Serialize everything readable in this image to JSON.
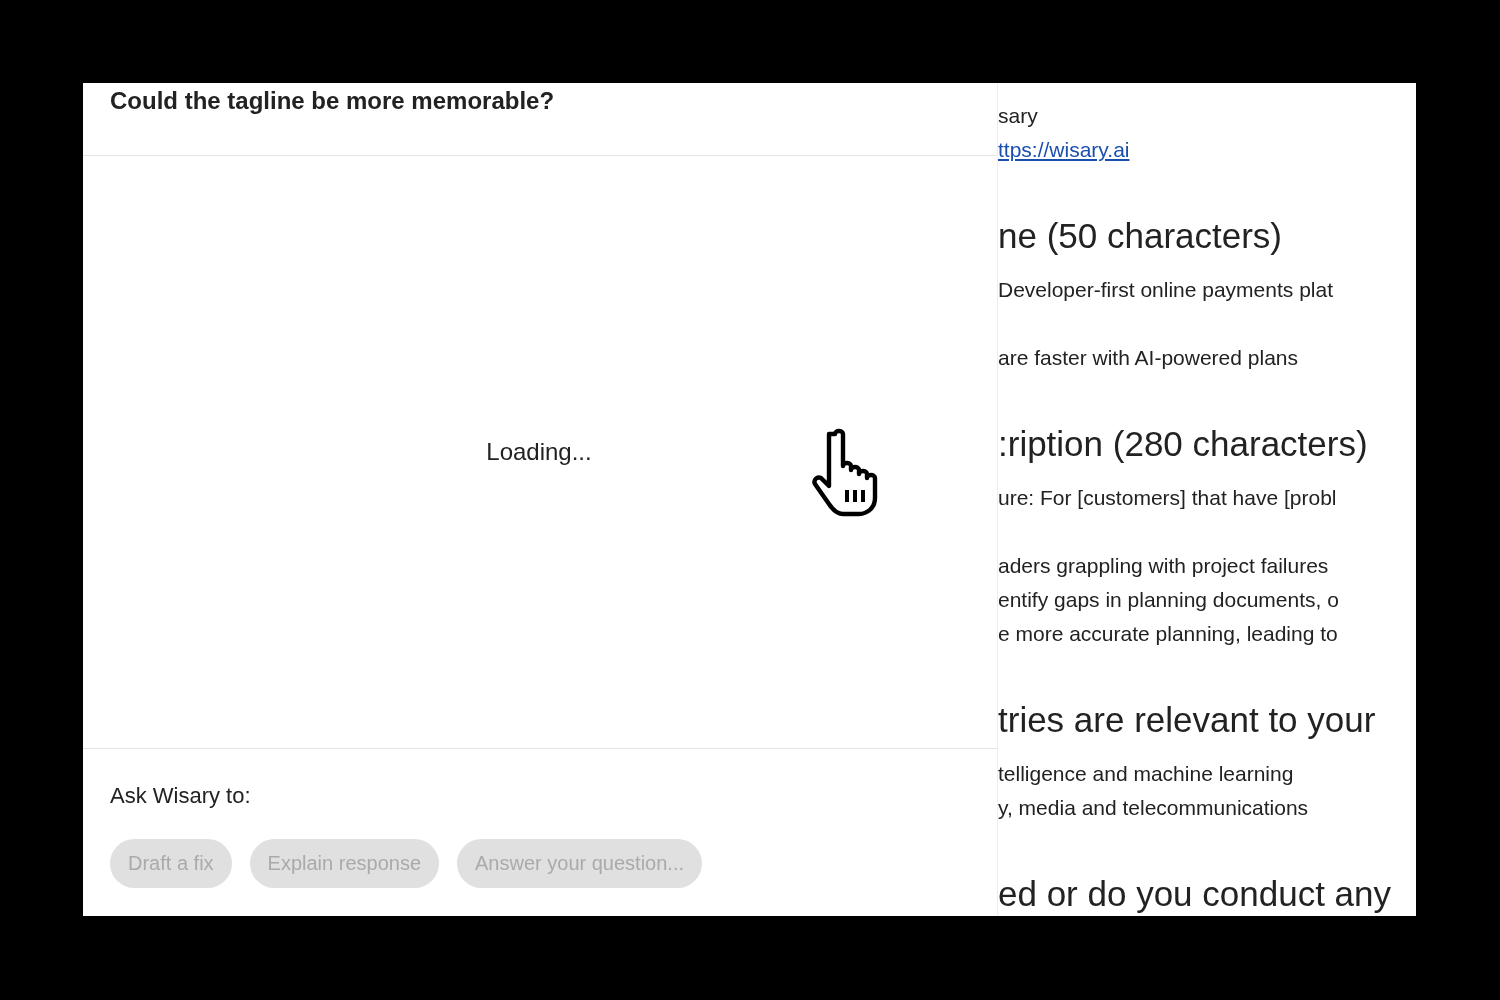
{
  "dialog": {
    "question": "Could the tagline be more memorable?",
    "status": "Loading...",
    "prompt_label": "Ask Wisary to:",
    "actions": [
      {
        "label": "Draft a fix",
        "disabled": true
      },
      {
        "label": "Explain response",
        "disabled": true
      },
      {
        "label": "Answer your question...",
        "disabled": true
      }
    ]
  },
  "document": {
    "lines": [
      {
        "kind": "text",
        "text": "sary"
      },
      {
        "kind": "link",
        "text": "ttps://wisary.ai"
      },
      {
        "kind": "heading",
        "text": "ne (50 characters)"
      },
      {
        "kind": "text",
        "text": "Developer-first online payments plat"
      },
      {
        "kind": "para",
        "text": "are faster with AI-powered plans"
      },
      {
        "kind": "heading",
        "text": ":ription (280 characters)"
      },
      {
        "kind": "text",
        "text": "ure: For [customers] that have [probl"
      },
      {
        "kind": "para",
        "text": "aders grappling with project failures"
      },
      {
        "kind": "text",
        "text": "entify gaps in planning documents, o"
      },
      {
        "kind": "text",
        "text": "e more accurate planning, leading to"
      },
      {
        "kind": "heading",
        "text": "tries are relevant to your"
      },
      {
        "kind": "text",
        "text": "telligence and machine learning"
      },
      {
        "kind": "text",
        "text": "y, media and telecommunications"
      },
      {
        "kind": "heading",
        "text": "ed or do you conduct any"
      }
    ]
  }
}
